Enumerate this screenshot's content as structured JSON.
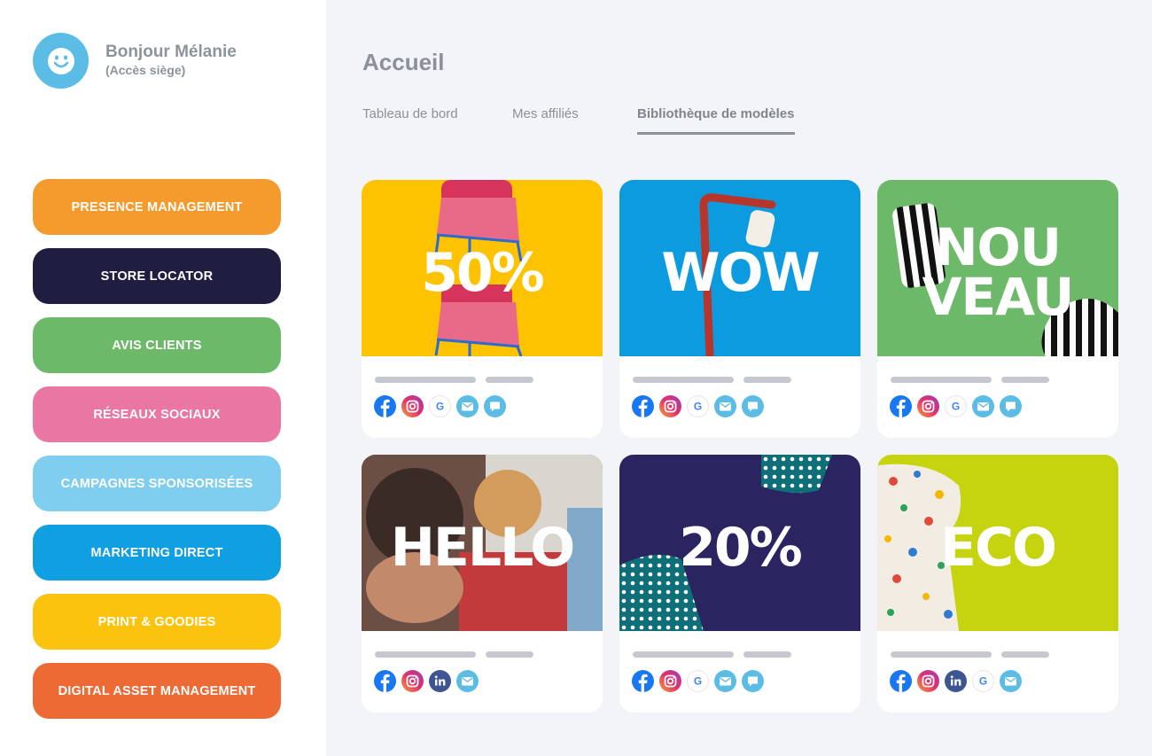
{
  "user": {
    "name": "Bonjour Mélanie",
    "role": "(Accès siège)"
  },
  "sidebar": {
    "items": [
      {
        "label": "PRESENCE MANAGEMENT",
        "color": "#f59a2d"
      },
      {
        "label": "STORE LOCATOR",
        "color": "#1f1d40"
      },
      {
        "label": "AVIS CLIENTS",
        "color": "#6cb96a"
      },
      {
        "label": "RÉSEAUX SOCIAUX",
        "color": "#ea76a4"
      },
      {
        "label": "CAMPAGNES SPONSORISÉES",
        "color": "#7fcef0"
      },
      {
        "label": "MARKETING DIRECT",
        "color": "#109fe1"
      },
      {
        "label": "PRINT & GOODIES",
        "color": "#fbc30e"
      },
      {
        "label": "DIGITAL ASSET MANAGEMENT",
        "color": "#ee6a34"
      }
    ]
  },
  "page": {
    "title": "Accueil"
  },
  "tabs": [
    {
      "label": "Tableau de bord",
      "active": false
    },
    {
      "label": "Mes affiliés",
      "active": false
    },
    {
      "label": "Bibliothèque de modèles",
      "active": true
    }
  ],
  "cards": [
    {
      "text": "50%",
      "bg": "#fdc200",
      "icons": [
        "facebook-icon",
        "instagram-icon",
        "google-icon",
        "email-icon",
        "chat-icon"
      ]
    },
    {
      "text": "WOW",
      "bg": "#0d9be0",
      "icons": [
        "facebook-icon",
        "instagram-icon",
        "google-icon",
        "email-icon",
        "chat-icon"
      ]
    },
    {
      "text": "NOUVEAU",
      "bg": "#6cb96a",
      "icons": [
        "facebook-icon",
        "instagram-icon",
        "google-icon",
        "email-icon",
        "chat-icon"
      ]
    },
    {
      "text": "HELLO",
      "bg": "#8a5a4a",
      "icons": [
        "facebook-icon",
        "instagram-icon",
        "linkedin-icon",
        "email-icon"
      ]
    },
    {
      "text": "20%",
      "bg": "#2a2460",
      "icons": [
        "facebook-icon",
        "instagram-icon",
        "google-icon",
        "email-icon",
        "chat-icon"
      ]
    },
    {
      "text": "ECO",
      "bg": "#c5d40f",
      "icons": [
        "facebook-icon",
        "instagram-icon",
        "linkedin-icon",
        "google-icon",
        "email-icon"
      ]
    }
  ]
}
